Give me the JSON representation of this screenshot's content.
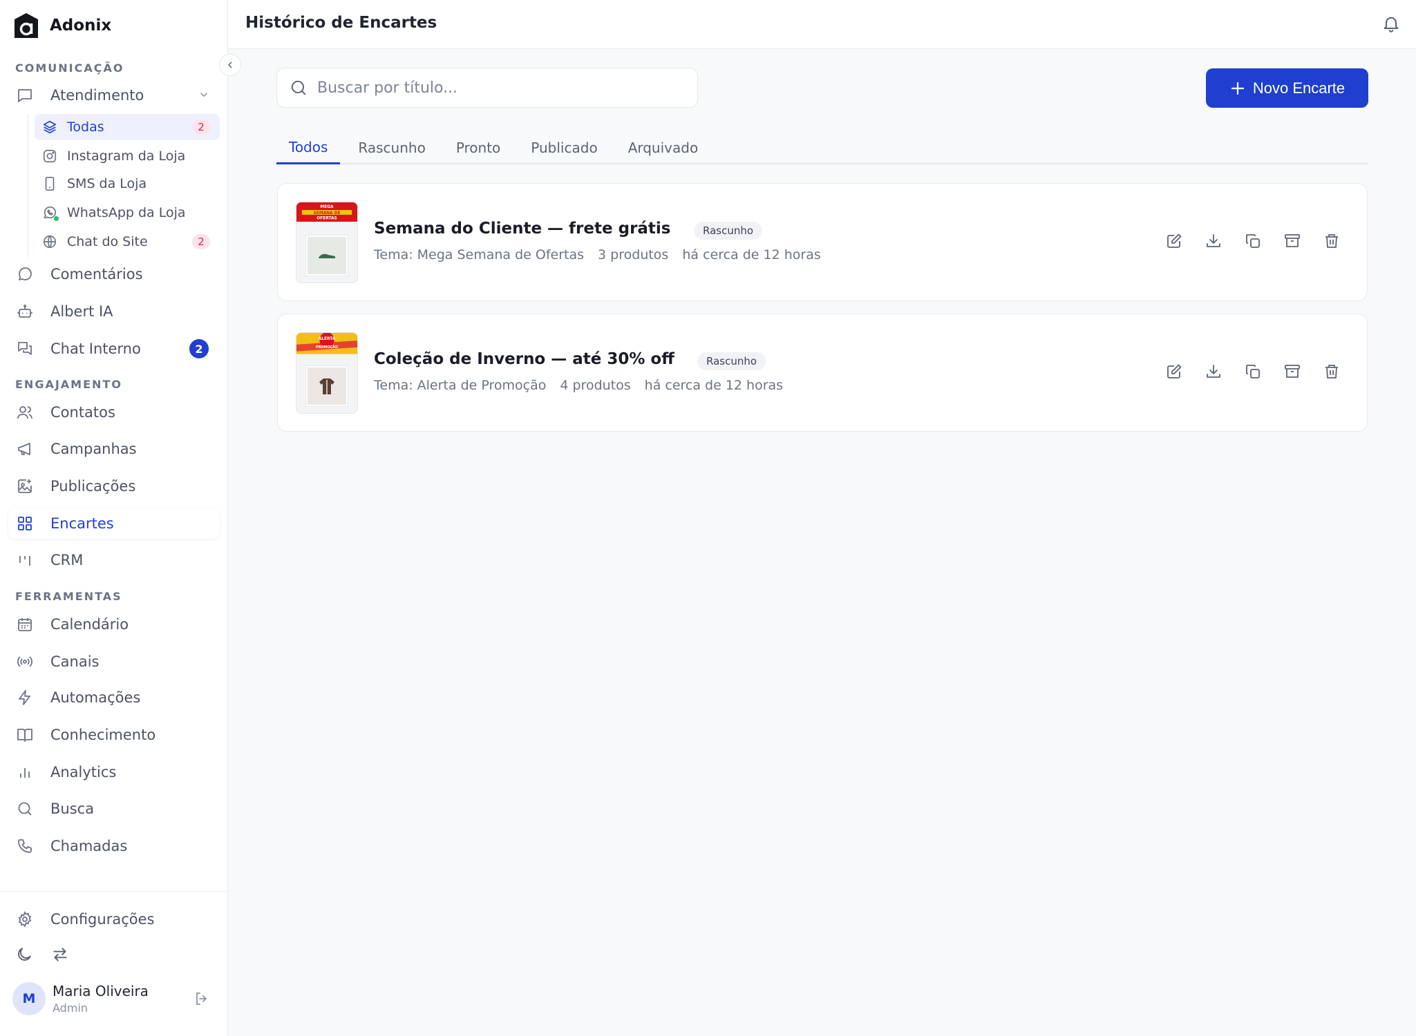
{
  "app": {
    "name": "Adonix"
  },
  "header": {
    "title": "Histórico de Encartes"
  },
  "sidebar": {
    "sections": {
      "comunicacao": "COMUNICAÇÃO",
      "engajamento": "ENGAJAMENTO",
      "ferramentas": "FERRAMENTAS"
    },
    "atendimento": {
      "label": "Atendimento",
      "children": [
        {
          "label": "Todas",
          "badge": "2"
        },
        {
          "label": "Instagram da Loja"
        },
        {
          "label": "SMS da Loja"
        },
        {
          "label": "WhatsApp da Loja"
        },
        {
          "label": "Chat do Site",
          "badge": "2"
        }
      ]
    },
    "items": {
      "comentarios": "Comentários",
      "albert": "Albert IA",
      "chat_interno": "Chat Interno",
      "chat_interno_badge": "2",
      "contatos": "Contatos",
      "campanhas": "Campanhas",
      "publicacoes": "Publicações",
      "encartes": "Encartes",
      "crm": "CRM",
      "calendario": "Calendário",
      "canais": "Canais",
      "automacoes": "Automações",
      "conhecimento": "Conhecimento",
      "analytics": "Analytics",
      "busca": "Busca",
      "chamadas": "Chamadas",
      "configuracoes": "Configurações"
    },
    "user": {
      "initial": "M",
      "name": "Maria Oliveira",
      "role": "Admin"
    }
  },
  "search": {
    "placeholder": "Buscar por título...",
    "value": ""
  },
  "new_button": {
    "label": "Novo Encarte"
  },
  "tabs": [
    "Todos",
    "Rascunho",
    "Pronto",
    "Publicado",
    "Arquivado"
  ],
  "cards": [
    {
      "title": "Semana do Cliente — frete grátis",
      "status": "Rascunho",
      "theme": "Tema: Mega Semana de Ofertas",
      "products": "3 produtos",
      "time": "há cerca de 12 horas",
      "thumb_text": [
        "MEGA",
        "SEMANA DE",
        "OFERTAS"
      ]
    },
    {
      "title": "Coleção de Inverno — até 30% off",
      "status": "Rascunho",
      "theme": "Tema: Alerta de Promoção",
      "products": "4 produtos",
      "time": "há cerca de 12 horas",
      "thumb_text": [
        "ALERTA",
        "PROMOÇÃO"
      ]
    }
  ],
  "colors": {
    "accent": "#1f3fd1",
    "badge_pink": "#d02a53",
    "online": "#22c55e"
  }
}
